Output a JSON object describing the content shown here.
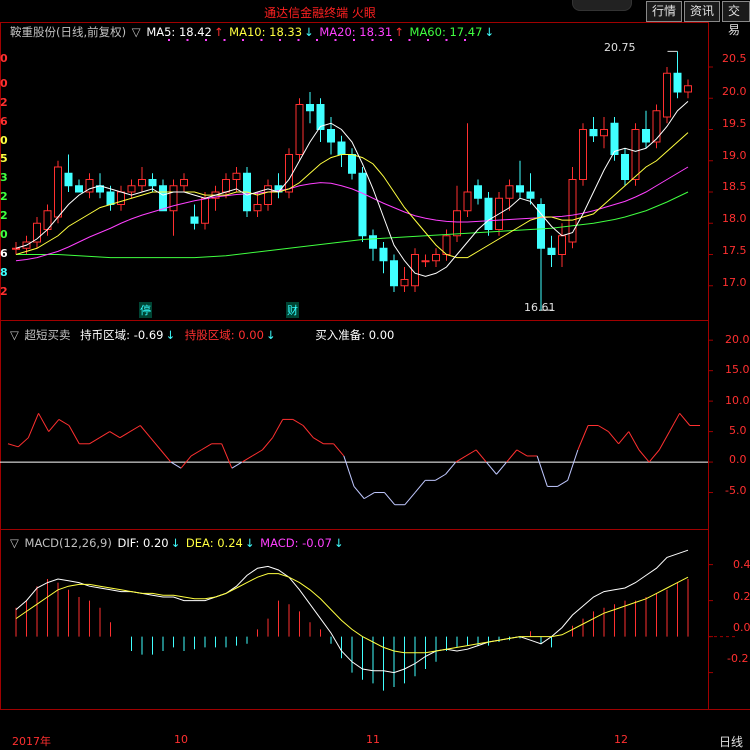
{
  "app": {
    "title": "通达信金融终端 火眼"
  },
  "menu": [
    "行情",
    "资讯",
    "交易"
  ],
  "period": "日线",
  "price_panel": {
    "stock": "鞍重股份(日线,前复权)",
    "ma5_label": "MA5: 18.42",
    "ma10_label": "MA10: 18.33",
    "ma20_label": "MA20: 18.31",
    "ma60_label": "MA60: 17.47",
    "high_label": "20.75",
    "low_label": "16.61",
    "axis": [
      "20.5",
      "20.0",
      "19.5",
      "19.0",
      "18.5",
      "18.0",
      "17.5",
      "17.0"
    ],
    "markers": [
      "停",
      "财"
    ]
  },
  "osc_panel": {
    "title": "超短买卖",
    "hold_label": "持币区域: -0.69",
    "hold_stock_label": "持股区域: 0.00",
    "ready_label": "买入准备: 0.00",
    "axis": [
      "20.0",
      "15.0",
      "10.0",
      "5.0",
      "0.0",
      "-5.0"
    ]
  },
  "macd_panel": {
    "title": "MACD(12,26,9)",
    "dif_label": "DIF: 0.20",
    "dea_label": "DEA: 0.24",
    "macd_label": "MACD: -0.07",
    "axis": [
      "0.4",
      "0.2",
      "0.0",
      "-0.2"
    ]
  },
  "xaxis": [
    "2017年",
    "10",
    "11",
    "12"
  ],
  "left_partial": [
    "0",
    "0",
    "2",
    "6",
    "0",
    "5",
    "3",
    "2",
    "2",
    "0",
    "6",
    "8",
    "2"
  ],
  "colors": {
    "up": "#ff3030",
    "down": "#40ffff",
    "ma5": "#ffffff",
    "ma10": "#ffff40",
    "ma20": "#ff40ff",
    "ma60": "#40ff40",
    "grid": "#a00000"
  },
  "chart_data": [
    {
      "type": "candlestick",
      "title": "鞍重股份(日线,前复权)",
      "ylim": [
        16.5,
        20.9
      ],
      "candles": [
        [
          17.6,
          17.7,
          17.5,
          17.6
        ],
        [
          17.6,
          17.8,
          17.5,
          17.7
        ],
        [
          17.7,
          18.1,
          17.6,
          18.0
        ],
        [
          17.9,
          18.3,
          17.8,
          18.2
        ],
        [
          18.1,
          19.0,
          18.0,
          18.9
        ],
        [
          18.8,
          19.1,
          18.5,
          18.6
        ],
        [
          18.6,
          18.7,
          18.5,
          18.5
        ],
        [
          18.5,
          18.8,
          18.4,
          18.7
        ],
        [
          18.6,
          18.8,
          18.4,
          18.5
        ],
        [
          18.5,
          18.6,
          18.2,
          18.3
        ],
        [
          18.3,
          18.6,
          18.2,
          18.5
        ],
        [
          18.5,
          18.7,
          18.4,
          18.6
        ],
        [
          18.6,
          18.9,
          18.5,
          18.7
        ],
        [
          18.7,
          18.8,
          18.5,
          18.6
        ],
        [
          18.6,
          18.7,
          18.2,
          18.2
        ],
        [
          18.2,
          18.7,
          17.8,
          18.6
        ],
        [
          18.6,
          18.8,
          18.5,
          18.7
        ],
        [
          18.1,
          18.3,
          17.9,
          18.0
        ],
        [
          18.0,
          18.5,
          17.9,
          18.4
        ],
        [
          18.4,
          18.6,
          18.2,
          18.5
        ],
        [
          18.5,
          18.8,
          18.4,
          18.7
        ],
        [
          18.7,
          18.9,
          18.5,
          18.8
        ],
        [
          18.8,
          18.9,
          18.1,
          18.2
        ],
        [
          18.2,
          18.5,
          18.1,
          18.3
        ],
        [
          18.3,
          18.7,
          18.2,
          18.6
        ],
        [
          18.6,
          18.8,
          18.4,
          18.5
        ],
        [
          18.5,
          19.2,
          18.4,
          19.1
        ],
        [
          19.1,
          20.0,
          19.0,
          19.9
        ],
        [
          19.9,
          20.1,
          19.6,
          19.8
        ],
        [
          19.9,
          20.0,
          19.3,
          19.5
        ],
        [
          19.5,
          19.7,
          19.1,
          19.3
        ],
        [
          19.3,
          19.4,
          18.9,
          19.1
        ],
        [
          19.1,
          19.2,
          18.7,
          18.8
        ],
        [
          18.8,
          18.9,
          17.7,
          17.8
        ],
        [
          17.8,
          17.9,
          17.4,
          17.6
        ],
        [
          17.6,
          17.7,
          17.2,
          17.4
        ],
        [
          17.4,
          17.5,
          16.9,
          17.0
        ],
        [
          17.0,
          17.3,
          16.9,
          17.1
        ],
        [
          17.0,
          17.6,
          16.9,
          17.5
        ],
        [
          17.4,
          17.5,
          17.3,
          17.4
        ],
        [
          17.4,
          17.6,
          17.3,
          17.5
        ],
        [
          17.5,
          17.9,
          17.4,
          17.8
        ],
        [
          17.8,
          18.6,
          17.7,
          18.2
        ],
        [
          18.2,
          19.6,
          18.1,
          18.5
        ],
        [
          18.6,
          18.7,
          18.3,
          18.4
        ],
        [
          18.4,
          18.5,
          17.8,
          17.9
        ],
        [
          17.9,
          18.5,
          17.8,
          18.4
        ],
        [
          18.4,
          18.7,
          18.2,
          18.6
        ],
        [
          18.6,
          19.0,
          18.4,
          18.5
        ],
        [
          18.5,
          18.8,
          18.3,
          18.4
        ],
        [
          18.3,
          18.4,
          16.6,
          17.6
        ],
        [
          17.6,
          17.8,
          17.3,
          17.5
        ],
        [
          17.5,
          18.0,
          17.3,
          17.8
        ],
        [
          17.7,
          18.9,
          17.6,
          18.7
        ],
        [
          18.7,
          19.6,
          18.6,
          19.5
        ],
        [
          19.5,
          19.7,
          19.3,
          19.4
        ],
        [
          19.4,
          19.7,
          19.2,
          19.5
        ],
        [
          19.6,
          19.7,
          19.0,
          19.1
        ],
        [
          19.1,
          19.2,
          18.6,
          18.7
        ],
        [
          18.7,
          19.6,
          18.6,
          19.5
        ],
        [
          19.5,
          19.8,
          19.2,
          19.3
        ],
        [
          19.3,
          19.9,
          19.2,
          19.8
        ],
        [
          19.7,
          20.5,
          19.6,
          20.4
        ],
        [
          20.4,
          20.75,
          20.0,
          20.1
        ],
        [
          20.1,
          20.3,
          20.0,
          20.2
        ]
      ],
      "ma5": [
        17.6,
        17.65,
        17.75,
        17.9,
        18.1,
        18.3,
        18.45,
        18.55,
        18.6,
        18.55,
        18.5,
        18.45,
        18.5,
        18.55,
        18.45,
        18.5,
        18.5,
        18.45,
        18.4,
        18.45,
        18.5,
        18.55,
        18.45,
        18.5,
        18.55,
        18.5,
        18.7,
        19.0,
        19.3,
        19.55,
        19.6,
        19.5,
        19.3,
        18.95,
        18.55,
        18.1,
        17.65,
        17.4,
        17.2,
        17.15,
        17.2,
        17.3,
        17.5,
        17.7,
        17.9,
        18.05,
        18.15,
        18.25,
        18.4,
        18.35,
        18.15,
        17.95,
        17.8,
        17.85,
        18.15,
        18.5,
        18.85,
        19.15,
        19.2,
        19.15,
        19.2,
        19.35,
        19.55,
        19.8,
        19.95
      ],
      "ma10": [
        17.5,
        17.55,
        17.6,
        17.7,
        17.8,
        17.95,
        18.05,
        18.15,
        18.25,
        18.3,
        18.35,
        18.4,
        18.45,
        18.5,
        18.5,
        18.5,
        18.5,
        18.5,
        18.45,
        18.45,
        18.45,
        18.5,
        18.5,
        18.45,
        18.5,
        18.5,
        18.55,
        18.65,
        18.8,
        18.95,
        19.05,
        19.1,
        19.1,
        19.05,
        18.95,
        18.75,
        18.5,
        18.25,
        18.05,
        17.85,
        17.65,
        17.5,
        17.45,
        17.45,
        17.55,
        17.65,
        17.75,
        17.85,
        17.95,
        18.05,
        18.1,
        18.1,
        18.05,
        18.05,
        18.1,
        18.15,
        18.3,
        18.45,
        18.6,
        18.75,
        18.9,
        19.0,
        19.15,
        19.3,
        19.45
      ],
      "ma20": [
        17.4,
        17.42,
        17.45,
        17.5,
        17.55,
        17.62,
        17.7,
        17.78,
        17.85,
        17.92,
        18.0,
        18.07,
        18.13,
        18.18,
        18.23,
        18.28,
        18.32,
        18.36,
        18.39,
        18.42,
        18.44,
        18.46,
        18.47,
        18.48,
        18.5,
        18.52,
        18.55,
        18.6,
        18.63,
        18.65,
        18.64,
        18.6,
        18.55,
        18.48,
        18.4,
        18.32,
        18.25,
        18.18,
        18.12,
        18.08,
        18.05,
        18.03,
        18.02,
        18.02,
        18.03,
        18.04,
        18.05,
        18.06,
        18.07,
        18.08,
        18.09,
        18.1,
        18.11,
        18.13,
        18.16,
        18.2,
        18.25,
        18.3,
        18.35,
        18.42,
        18.5,
        18.6,
        18.7,
        18.8,
        18.9
      ],
      "ma60": [
        17.5,
        17.5,
        17.5,
        17.5,
        17.5,
        17.49,
        17.48,
        17.47,
        17.46,
        17.45,
        17.45,
        17.45,
        17.45,
        17.45,
        17.45,
        17.45,
        17.45,
        17.45,
        17.46,
        17.47,
        17.48,
        17.5,
        17.52,
        17.54,
        17.56,
        17.58,
        17.6,
        17.62,
        17.64,
        17.66,
        17.68,
        17.7,
        17.72,
        17.74,
        17.75,
        17.76,
        17.77,
        17.78,
        17.79,
        17.8,
        17.81,
        17.82,
        17.83,
        17.84,
        17.85,
        17.86,
        17.87,
        17.88,
        17.89,
        17.9,
        17.91,
        17.92,
        17.94,
        17.96,
        17.98,
        18.0,
        18.03,
        18.06,
        18.1,
        18.15,
        18.2,
        18.27,
        18.34,
        18.42,
        18.5
      ]
    },
    {
      "type": "line",
      "title": "超短买卖",
      "ylim": [
        -10,
        22
      ],
      "values": [
        3,
        2.5,
        4,
        8,
        5,
        7,
        6,
        3,
        3,
        4,
        5,
        4,
        5,
        6,
        4,
        2,
        0,
        -1,
        1,
        2,
        3,
        3,
        -1,
        0,
        1,
        2,
        4,
        7,
        7,
        6,
        4,
        3,
        3,
        1,
        -4,
        -6,
        -5,
        -5,
        -7,
        -7,
        -5,
        -3,
        -3,
        -2,
        0,
        1,
        2,
        0,
        -2,
        0,
        2,
        1,
        1,
        -4,
        -4,
        -3,
        2,
        6,
        6,
        5,
        3,
        5,
        2,
        0,
        2,
        5,
        8,
        6,
        6
      ]
    },
    {
      "type": "bar+line",
      "title": "MACD(12,26,9)",
      "ylim": [
        -0.38,
        0.52
      ],
      "macd": [
        0.16,
        0.2,
        0.28,
        0.32,
        0.3,
        0.26,
        0.22,
        0.2,
        0.16,
        0.08,
        0.0,
        -0.08,
        -0.1,
        -0.1,
        -0.08,
        -0.06,
        -0.08,
        -0.07,
        -0.06,
        -0.06,
        -0.06,
        -0.05,
        -0.04,
        0.04,
        0.1,
        0.2,
        0.18,
        0.14,
        0.08,
        0.04,
        -0.04,
        -0.12,
        -0.2,
        -0.24,
        -0.26,
        -0.3,
        -0.28,
        -0.26,
        -0.22,
        -0.18,
        -0.14,
        -0.08,
        -0.06,
        -0.05,
        -0.05,
        -0.05,
        -0.03,
        -0.02,
        -0.01,
        0.03,
        -0.04,
        -0.06,
        0.0,
        0.06,
        0.1,
        0.14,
        0.16,
        0.18,
        0.2,
        0.2,
        0.22,
        0.24,
        0.26,
        0.3,
        0.32
      ],
      "dif": [
        0.15,
        0.2,
        0.27,
        0.3,
        0.32,
        0.31,
        0.3,
        0.28,
        0.27,
        0.26,
        0.25,
        0.25,
        0.24,
        0.23,
        0.22,
        0.22,
        0.2,
        0.2,
        0.2,
        0.22,
        0.24,
        0.28,
        0.34,
        0.38,
        0.39,
        0.37,
        0.33,
        0.26,
        0.18,
        0.1,
        0.02,
        -0.08,
        -0.14,
        -0.18,
        -0.19,
        -0.19,
        -0.2,
        -0.18,
        -0.15,
        -0.11,
        -0.08,
        -0.07,
        -0.08,
        -0.07,
        -0.05,
        -0.03,
        -0.02,
        -0.01,
        0.0,
        -0.02,
        -0.04,
        0.0,
        0.05,
        0.12,
        0.17,
        0.22,
        0.25,
        0.26,
        0.27,
        0.3,
        0.34,
        0.38,
        0.44,
        0.46,
        0.48
      ],
      "dea": [
        0.1,
        0.14,
        0.18,
        0.22,
        0.26,
        0.28,
        0.29,
        0.29,
        0.28,
        0.27,
        0.26,
        0.25,
        0.24,
        0.24,
        0.23,
        0.23,
        0.22,
        0.21,
        0.21,
        0.22,
        0.24,
        0.27,
        0.3,
        0.33,
        0.35,
        0.35,
        0.33,
        0.3,
        0.26,
        0.21,
        0.15,
        0.09,
        0.04,
        0.0,
        -0.03,
        -0.06,
        -0.08,
        -0.09,
        -0.09,
        -0.09,
        -0.08,
        -0.07,
        -0.06,
        -0.05,
        -0.04,
        -0.03,
        -0.02,
        -0.01,
        0.0,
        0.0,
        0.0,
        0.0,
        0.01,
        0.04,
        0.07,
        0.1,
        0.13,
        0.15,
        0.17,
        0.19,
        0.21,
        0.24,
        0.27,
        0.3,
        0.33
      ]
    }
  ]
}
